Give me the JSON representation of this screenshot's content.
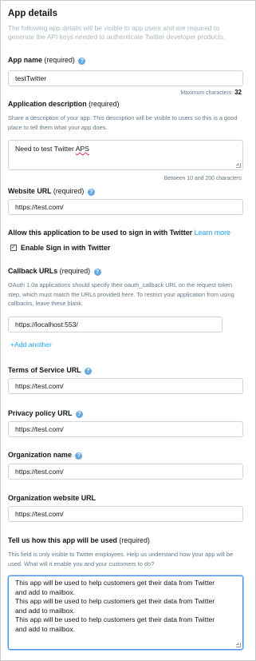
{
  "section": {
    "title": "App details",
    "intro": "The following app details will be visible to app users and are required to generate the API keys needed to authenticate Twitter developer products."
  },
  "app_name": {
    "label": "App name",
    "req": "(required)",
    "value": "testTwitter",
    "max_label": "Maximum characters:",
    "max_value": "32"
  },
  "app_desc": {
    "label": "Application description",
    "req": "(required)",
    "desc": "Share a description of your app. This description will be visible to users so this is a good place to tell them what your app does.",
    "value_plain": "Need to test Twitter ",
    "value_flagged": "APS",
    "limit": "Between 10 and 200 characters"
  },
  "website": {
    "label": "Website URL",
    "req": "(required)",
    "value": "https://test.com/"
  },
  "signin": {
    "label": "Allow this application to be used to sign in with Twitter",
    "learn_more": "Learn more",
    "checkbox_label": "Enable Sign in with Twitter",
    "checked": true
  },
  "callback": {
    "label": "Callback URLs",
    "req": "(required)",
    "desc": "OAuth 1.0a applications should specify their oauth_callback URL on the request token step, which must match the URLs provided here. To restrict your application from using callbacks, leave these blank.",
    "value": "https://localhost:553/",
    "add_another": "+Add another"
  },
  "tos": {
    "label": "Terms of Service URL",
    "value": "https://test.com/"
  },
  "privacy": {
    "label": "Privacy policy URL",
    "value": "https://test.com/"
  },
  "org_name": {
    "label": "Organization name",
    "value": "https://test.com/"
  },
  "org_website": {
    "label": "Organization website URL",
    "value": "https://test.com/"
  },
  "usage": {
    "label": "Tell us how this app will be used",
    "req": "(required)",
    "desc": "This field is only visible to Twitter employees. Help us understand how your app will be used. What will it enable you and your customers to do?",
    "lines": [
      "This app will be used to help customers get their data from Twitter",
      "and add to mailbox.",
      "This app will be used to help customers get their data from Twitter",
      "and add to mailbox.",
      "This app will be used to help customers get their data from Twitter",
      "and add to mailbox."
    ]
  },
  "icons": {
    "help": "question-circle-icon",
    "checkbox": "checkmark-icon",
    "resize": "resize-grip-icon"
  },
  "colors": {
    "accent": "#1da1f2",
    "help_icon": "#66a8e0",
    "focus_border": "#4a90e2",
    "muted": "#657786"
  }
}
